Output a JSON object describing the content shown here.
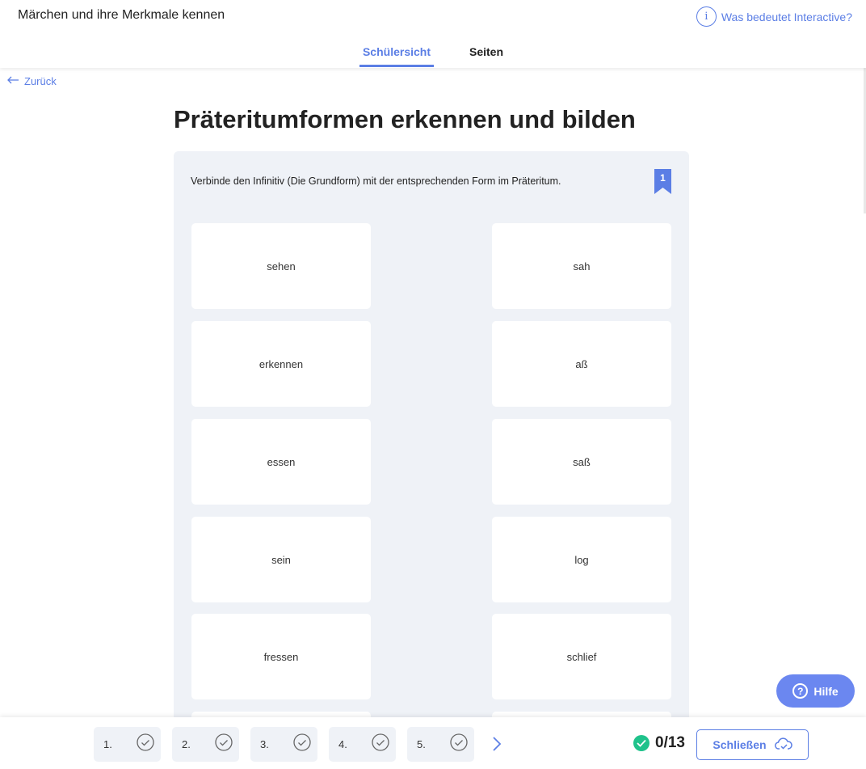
{
  "header": {
    "app_title": "Märchen und ihre Merkmale kennen",
    "info_link": "Was bedeutet Interactive?",
    "info_icon": "i",
    "tabs": [
      {
        "label": "Schülersicht",
        "active": true
      },
      {
        "label": "Seiten",
        "active": false
      }
    ]
  },
  "nav": {
    "back_label": "Zurück"
  },
  "page": {
    "title": "Präteritumformen erkennen und bilden"
  },
  "exercise": {
    "instruction": "Verbinde den Infinitiv (Die Grundform) mit der entsprechenden Form im Präteritum.",
    "badge_number": "1",
    "left_cards": [
      "sehen",
      "erkennen",
      "essen",
      "sein",
      "fressen"
    ],
    "right_cards": [
      "sah",
      "aß",
      "saß",
      "log",
      "schlief"
    ]
  },
  "footer": {
    "steps": [
      "1.",
      "2.",
      "3.",
      "4.",
      "5."
    ],
    "score": "0/13",
    "close_label": "Schließen"
  },
  "help": {
    "label": "Hilfe",
    "icon": "?"
  },
  "colors": {
    "accent": "#5b7ee5",
    "success": "#1fc28b",
    "panel": "#eff2f7"
  }
}
